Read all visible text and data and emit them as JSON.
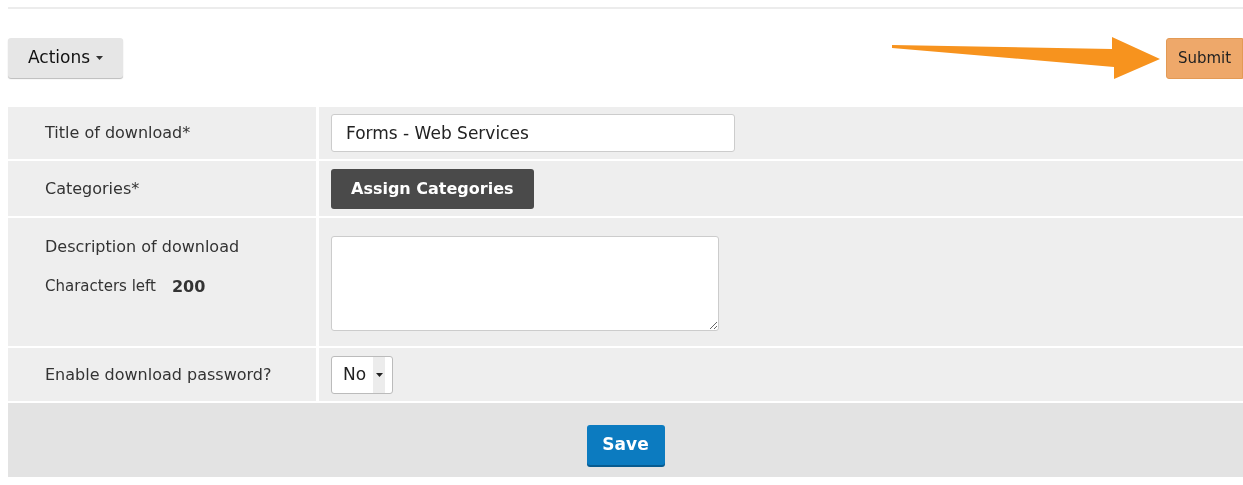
{
  "toolbar": {
    "actions_button": "Actions",
    "submit_button": "Submit"
  },
  "form": {
    "rows": [
      {
        "label": "Title of download*",
        "kind": "text",
        "value": "Forms - Web Services"
      },
      {
        "label": "Categories*",
        "kind": "button",
        "button": "Assign Categories"
      },
      {
        "label": "Description of download",
        "kind": "textarea",
        "counter_label": "Characters left",
        "counter_value": "200"
      },
      {
        "label": "Enable download password?",
        "kind": "select",
        "value": "No"
      }
    ],
    "save_button": "Save"
  }
}
